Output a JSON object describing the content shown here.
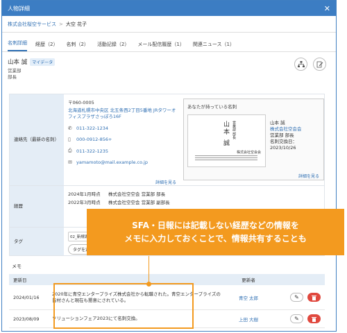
{
  "window": {
    "title": "人物詳細"
  },
  "breadcrumb": {
    "company": "株式会社桜空サービス",
    "separator": ">",
    "person": "大空 花子"
  },
  "tabs": [
    {
      "label": "名刺詳細"
    },
    {
      "label": "経歴（2）"
    },
    {
      "label": "名刺（2）"
    },
    {
      "label": "活動記録（2）"
    },
    {
      "label": "メール配信履歴（1）"
    },
    {
      "label": "関連ニュース（1）"
    }
  ],
  "person": {
    "name": "山本 誠",
    "badge": "マイデータ",
    "department": "営業部",
    "position": "部長"
  },
  "contact": {
    "label": "連絡先（最新の名刺）",
    "postal": "〒060-0005",
    "address": "北海道札幌市中央区 北五条西2丁目5番地 JRタワーオフィスプラザさっぽろ16F",
    "phone1": "011-322-1234",
    "mobile": "000-0912-856+",
    "phone2": "011-322-1235",
    "email": "yamamoto@mail.example.co.jp",
    "detail_link": "詳細を見る"
  },
  "business_card": {
    "title": "あなたが持っている名刺",
    "card_name": "山本 誠",
    "card_title": "営業部 部長",
    "card_company": "株式会社空会会",
    "name": "山本 誠",
    "company": "株式会社空会会",
    "dept": "営業部 部長",
    "exchange_date": "名刺交換日：2023/10/26",
    "more_link": "詳細を見る"
  },
  "career": {
    "label": "経歴",
    "entries": [
      {
        "date": "2024年1月時点",
        "text": "株式会社空空会 営業部 部長"
      },
      {
        "date": "2022年3月時点",
        "text": "株式会社空空会 営業部 副部長"
      }
    ]
  },
  "tags": {
    "label": "タグ",
    "input_placeholder": "02_新規導入",
    "chip": "タグを追加"
  },
  "memo": {
    "title": "メモ",
    "col_date": "更新日",
    "col_user": "更新者",
    "rows": [
      {
        "date": "2024/01/16",
        "text": "2020年に青空エンタープライズ株式会社から転職された。青空エンタープライズの皆村さんと現在も懇意にされている。",
        "user": "青空 太郎"
      },
      {
        "date": "2023/08/09",
        "text": "ソリューションフェア2023にて名刺交換。",
        "user": "上田 大樹"
      }
    ]
  },
  "callout": {
    "line1": "SFA・日報には記載しない経歴などの情報を",
    "line2": "メモに入力しておくことで、情報共有することも"
  },
  "colors": {
    "primary": "#3c7dc3",
    "accent": "#f39a1f",
    "danger": "#e0483e"
  }
}
